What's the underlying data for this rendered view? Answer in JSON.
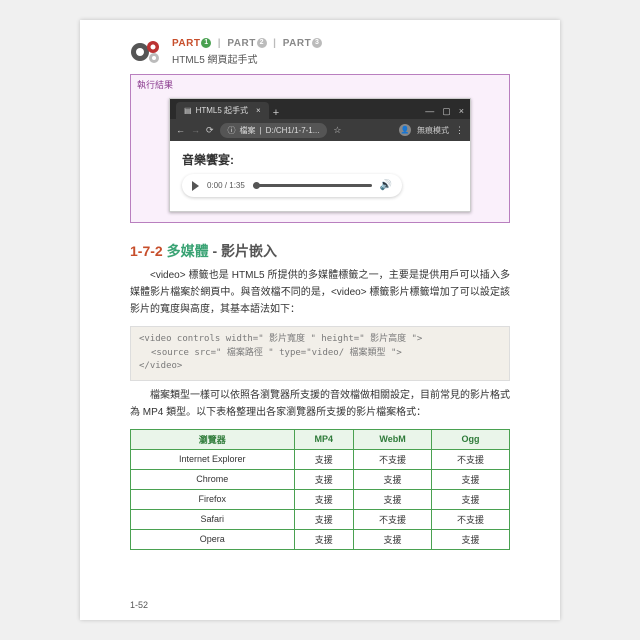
{
  "header": {
    "part1": "PART",
    "part2": "PART",
    "part3": "PART",
    "n1": "1",
    "n2": "2",
    "n3": "3",
    "subtitle": "HTML5 網頁起手式"
  },
  "result": {
    "title": "執行結果",
    "tab_label": "HTML5 起手式",
    "url_prefix": "檔案",
    "url_text": "D:/CH1/1-7-1...",
    "mode_label": "無痕模式",
    "heading": "音樂饗宴:",
    "time": "0:00 / 1:35"
  },
  "section": {
    "num": "1-7-2",
    "title_main": "多媒體",
    "title_sub": " - 影片嵌入"
  },
  "para1": "<video> 標籤也是 HTML5 所提供的多媒體標籤之一，主要是提供用戶可以插入多媒體影片檔案於網頁中。與音效檔不同的是，<video> 標籤影片標籤增加了可以設定該影片的寬度與高度，其基本語法如下：",
  "code": {
    "l1": "<video controls width=\" 影片寬度 \" height=\" 影片高度 \">",
    "l2": "<source src=\" 檔案路徑 \" type=\"video/ 檔案類型 \">",
    "l3": "</video>"
  },
  "para2": "檔案類型一樣可以依照各瀏覽器所支援的音效檔做相關設定，目前常見的影片格式為 MP4 類型。以下表格整理出各家瀏覽器所支援的影片檔案格式：",
  "table": {
    "headers": [
      "瀏覽器",
      "MP4",
      "WebM",
      "Ogg"
    ],
    "rows": [
      [
        "Internet Explorer",
        "支援",
        "不支援",
        "不支援"
      ],
      [
        "Chrome",
        "支援",
        "支援",
        "支援"
      ],
      [
        "Firefox",
        "支援",
        "支援",
        "支援"
      ],
      [
        "Safari",
        "支援",
        "不支援",
        "不支援"
      ],
      [
        "Opera",
        "支援",
        "支援",
        "支援"
      ]
    ]
  },
  "page_number": "1-52"
}
